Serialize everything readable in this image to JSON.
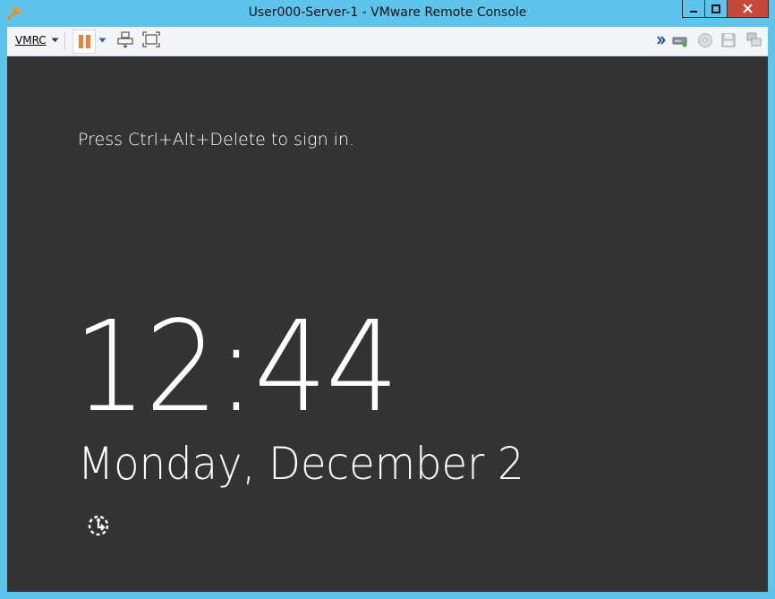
{
  "window": {
    "title": "User000-Server-1 - VMware Remote Console"
  },
  "toolbar": {
    "menu_label": "VMRC",
    "menu_icon": "chevron-down-icon",
    "pause_icon": "pause-icon",
    "power_dropdown_icon": "triangle-down-icon",
    "send_keys_icon": "keyboard-send-icon",
    "fullscreen_icon": "fullscreen-icon",
    "overflow_icon": "double-chevron-right-icon",
    "devices": [
      "hard-drive-icon",
      "cd-dvd-icon",
      "floppy-icon",
      "network-adapter-icon"
    ]
  },
  "lockscreen": {
    "prompt": "Press Ctrl+Alt+Delete to sign in.",
    "time": "12:44",
    "date": "Monday, December 2",
    "ease_of_access_icon": "ease-of-access-icon"
  },
  "colors": {
    "titlebar_bg": "#5ec4ec",
    "close_bg": "#c7483a",
    "toolbar_bg": "#f4f5f7",
    "console_bg": "#333333",
    "pause_color": "#e1834b",
    "accent_blue": "#2a5fb0"
  }
}
